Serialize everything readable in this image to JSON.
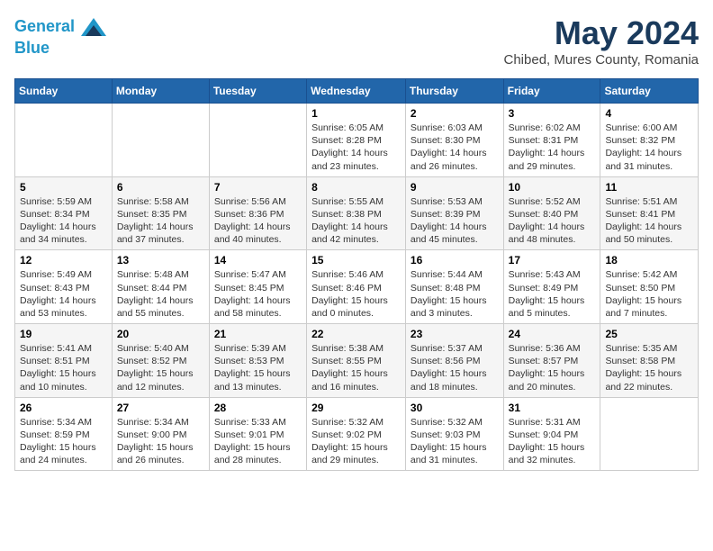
{
  "header": {
    "logo_line1": "General",
    "logo_line2": "Blue",
    "month_title": "May 2024",
    "subtitle": "Chibed, Mures County, Romania"
  },
  "days_of_week": [
    "Sunday",
    "Monday",
    "Tuesday",
    "Wednesday",
    "Thursday",
    "Friday",
    "Saturday"
  ],
  "weeks": [
    [
      {
        "day": "",
        "info": ""
      },
      {
        "day": "",
        "info": ""
      },
      {
        "day": "",
        "info": ""
      },
      {
        "day": "1",
        "info": "Sunrise: 6:05 AM\nSunset: 8:28 PM\nDaylight: 14 hours\nand 23 minutes."
      },
      {
        "day": "2",
        "info": "Sunrise: 6:03 AM\nSunset: 8:30 PM\nDaylight: 14 hours\nand 26 minutes."
      },
      {
        "day": "3",
        "info": "Sunrise: 6:02 AM\nSunset: 8:31 PM\nDaylight: 14 hours\nand 29 minutes."
      },
      {
        "day": "4",
        "info": "Sunrise: 6:00 AM\nSunset: 8:32 PM\nDaylight: 14 hours\nand 31 minutes."
      }
    ],
    [
      {
        "day": "5",
        "info": "Sunrise: 5:59 AM\nSunset: 8:34 PM\nDaylight: 14 hours\nand 34 minutes."
      },
      {
        "day": "6",
        "info": "Sunrise: 5:58 AM\nSunset: 8:35 PM\nDaylight: 14 hours\nand 37 minutes."
      },
      {
        "day": "7",
        "info": "Sunrise: 5:56 AM\nSunset: 8:36 PM\nDaylight: 14 hours\nand 40 minutes."
      },
      {
        "day": "8",
        "info": "Sunrise: 5:55 AM\nSunset: 8:38 PM\nDaylight: 14 hours\nand 42 minutes."
      },
      {
        "day": "9",
        "info": "Sunrise: 5:53 AM\nSunset: 8:39 PM\nDaylight: 14 hours\nand 45 minutes."
      },
      {
        "day": "10",
        "info": "Sunrise: 5:52 AM\nSunset: 8:40 PM\nDaylight: 14 hours\nand 48 minutes."
      },
      {
        "day": "11",
        "info": "Sunrise: 5:51 AM\nSunset: 8:41 PM\nDaylight: 14 hours\nand 50 minutes."
      }
    ],
    [
      {
        "day": "12",
        "info": "Sunrise: 5:49 AM\nSunset: 8:43 PM\nDaylight: 14 hours\nand 53 minutes."
      },
      {
        "day": "13",
        "info": "Sunrise: 5:48 AM\nSunset: 8:44 PM\nDaylight: 14 hours\nand 55 minutes."
      },
      {
        "day": "14",
        "info": "Sunrise: 5:47 AM\nSunset: 8:45 PM\nDaylight: 14 hours\nand 58 minutes."
      },
      {
        "day": "15",
        "info": "Sunrise: 5:46 AM\nSunset: 8:46 PM\nDaylight: 15 hours\nand 0 minutes."
      },
      {
        "day": "16",
        "info": "Sunrise: 5:44 AM\nSunset: 8:48 PM\nDaylight: 15 hours\nand 3 minutes."
      },
      {
        "day": "17",
        "info": "Sunrise: 5:43 AM\nSunset: 8:49 PM\nDaylight: 15 hours\nand 5 minutes."
      },
      {
        "day": "18",
        "info": "Sunrise: 5:42 AM\nSunset: 8:50 PM\nDaylight: 15 hours\nand 7 minutes."
      }
    ],
    [
      {
        "day": "19",
        "info": "Sunrise: 5:41 AM\nSunset: 8:51 PM\nDaylight: 15 hours\nand 10 minutes."
      },
      {
        "day": "20",
        "info": "Sunrise: 5:40 AM\nSunset: 8:52 PM\nDaylight: 15 hours\nand 12 minutes."
      },
      {
        "day": "21",
        "info": "Sunrise: 5:39 AM\nSunset: 8:53 PM\nDaylight: 15 hours\nand 13 minutes."
      },
      {
        "day": "22",
        "info": "Sunrise: 5:38 AM\nSunset: 8:55 PM\nDaylight: 15 hours\nand 16 minutes."
      },
      {
        "day": "23",
        "info": "Sunrise: 5:37 AM\nSunset: 8:56 PM\nDaylight: 15 hours\nand 18 minutes."
      },
      {
        "day": "24",
        "info": "Sunrise: 5:36 AM\nSunset: 8:57 PM\nDaylight: 15 hours\nand 20 minutes."
      },
      {
        "day": "25",
        "info": "Sunrise: 5:35 AM\nSunset: 8:58 PM\nDaylight: 15 hours\nand 22 minutes."
      }
    ],
    [
      {
        "day": "26",
        "info": "Sunrise: 5:34 AM\nSunset: 8:59 PM\nDaylight: 15 hours\nand 24 minutes."
      },
      {
        "day": "27",
        "info": "Sunrise: 5:34 AM\nSunset: 9:00 PM\nDaylight: 15 hours\nand 26 minutes."
      },
      {
        "day": "28",
        "info": "Sunrise: 5:33 AM\nSunset: 9:01 PM\nDaylight: 15 hours\nand 28 minutes."
      },
      {
        "day": "29",
        "info": "Sunrise: 5:32 AM\nSunset: 9:02 PM\nDaylight: 15 hours\nand 29 minutes."
      },
      {
        "day": "30",
        "info": "Sunrise: 5:32 AM\nSunset: 9:03 PM\nDaylight: 15 hours\nand 31 minutes."
      },
      {
        "day": "31",
        "info": "Sunrise: 5:31 AM\nSunset: 9:04 PM\nDaylight: 15 hours\nand 32 minutes."
      },
      {
        "day": "",
        "info": ""
      }
    ]
  ]
}
